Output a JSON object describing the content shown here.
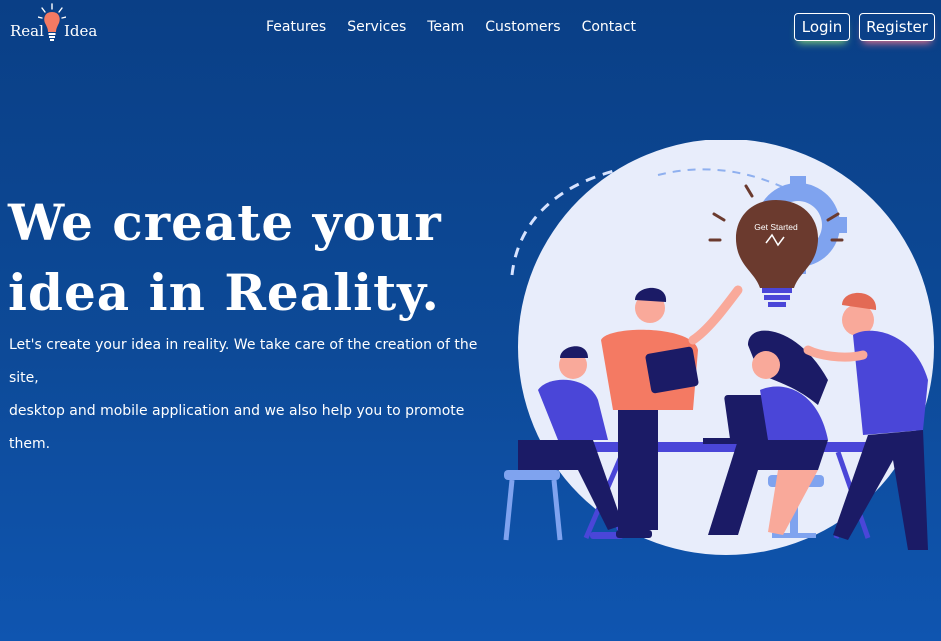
{
  "logo": {
    "word1": "Real",
    "word2": "Idea",
    "icon": "lightbulb-icon"
  },
  "nav": {
    "items": [
      {
        "label": "Features"
      },
      {
        "label": "Services"
      },
      {
        "label": "Team"
      },
      {
        "label": "Customers"
      },
      {
        "label": "Contact"
      }
    ]
  },
  "auth": {
    "login_label": "Login",
    "register_label": "Register"
  },
  "hero": {
    "title_line1": "We create your",
    "title_line2": "idea in Reality.",
    "subtitle_line1": "Let's create your idea in reality. We take care of the creation of the site,",
    "subtitle_line2": "desktop and mobile application and we also help you to promote them."
  },
  "illustration": {
    "bulb_label": "Get Started"
  },
  "colors": {
    "bg_top": "#0a3f86",
    "bg_bottom": "#0f55b0",
    "bulb": "#f47a63",
    "accent_purple": "#4a46d8"
  }
}
